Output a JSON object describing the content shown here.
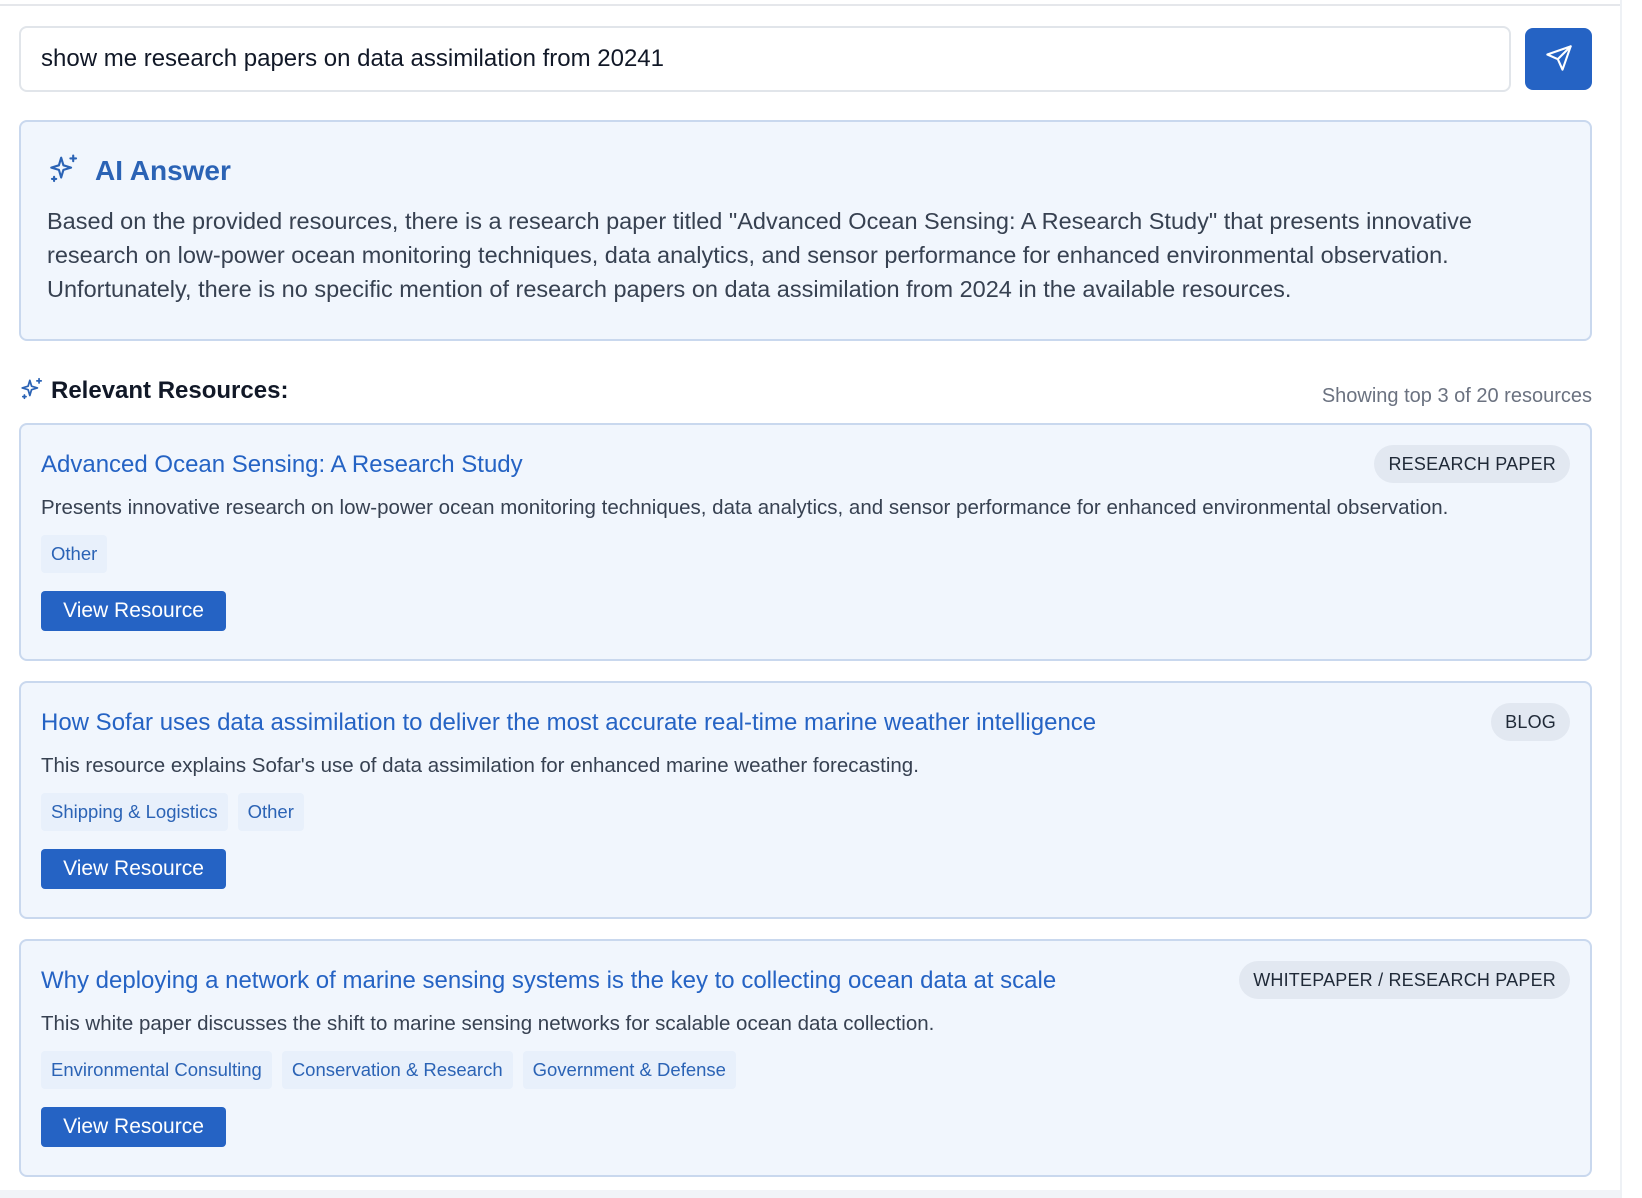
{
  "search": {
    "value": "show me research papers on data assimilation from 20241"
  },
  "send_icon": "paper-plane-icon",
  "ai_answer": {
    "icon": "sparkles-icon",
    "title": "AI Answer",
    "text": "Based on the provided resources, there is a research paper titled \"Advanced Ocean Sensing: A Research Study\" that presents innovative research on low-power ocean monitoring techniques, data analytics, and sensor performance for enhanced environmental observation. Unfortunately, there is no specific mention of research papers on data assimilation from 2024 in the available resources."
  },
  "resources": {
    "icon": "sparkles-icon",
    "title": "Relevant Resources:",
    "count_text": "Showing top 3 of 20 resources",
    "items": [
      {
        "title": "Advanced Ocean Sensing: A Research Study",
        "type": "RESEARCH PAPER",
        "description": "Presents innovative research on low-power ocean monitoring techniques, data analytics, and sensor performance for enhanced environmental observation.",
        "tags": [
          "Other"
        ],
        "button": "View Resource"
      },
      {
        "title": "How Sofar uses data assimilation to deliver the most accurate real-time marine weather intelligence",
        "type": "BLOG",
        "description": "This resource explains Sofar's use of data assimilation for enhanced marine weather forecasting.",
        "tags": [
          "Shipping & Logistics",
          "Other"
        ],
        "button": "View Resource"
      },
      {
        "title": "Why deploying a network of marine sensing systems is the key to collecting ocean data at scale",
        "type": "WHITEPAPER / RESEARCH PAPER",
        "description": "This white paper discusses the shift to marine sensing networks for scalable ocean data collection.",
        "tags": [
          "Environmental Consulting",
          "Conservation & Research",
          "Government & Defense"
        ],
        "button": "View Resource"
      }
    ]
  },
  "colors": {
    "accent": "#2563c4",
    "card_bg": "#f1f6fd",
    "card_border": "#c9d8ee"
  }
}
